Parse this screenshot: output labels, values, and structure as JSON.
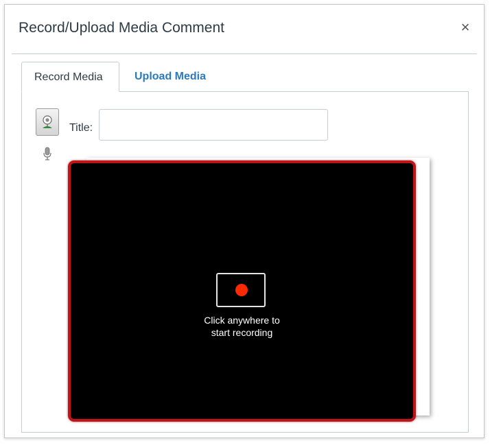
{
  "dialog": {
    "title": "Record/Upload Media Comment",
    "close_symbol": "×"
  },
  "tabs": [
    {
      "label": "Record Media",
      "active": true
    },
    {
      "label": "Upload Media",
      "active": false
    }
  ],
  "record_panel": {
    "webcam_icon": "webcam-icon",
    "mic_icon": "microphone-icon",
    "title_label": "Title:",
    "title_value": "",
    "recorder": {
      "hint_line1": "Click anywhere to",
      "hint_line2": "start recording",
      "border_color": "#c0141a",
      "record_dot_color": "#ff2a00"
    }
  },
  "colors": {
    "link": "#2b7abc",
    "text": "#2d3b45"
  }
}
